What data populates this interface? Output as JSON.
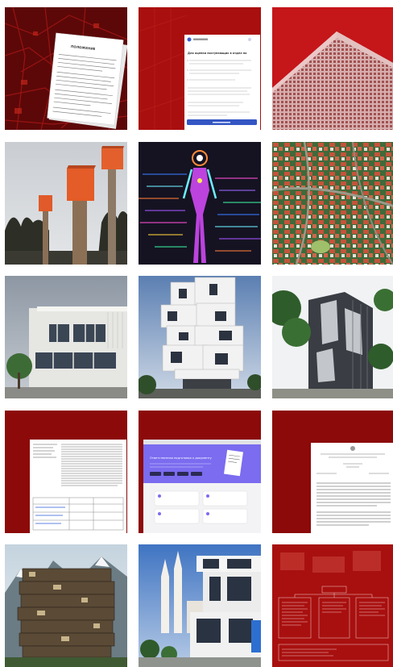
{
  "gallery": {
    "tiles": [
      {
        "id": "tile-1",
        "subject": "Paper document on red map background",
        "doc_title": "ПОЛОЖЕНИЕ"
      },
      {
        "id": "tile-2",
        "subject": "Web form dialog on red background",
        "form_title": "Для оценки поступающих в отдел по"
      },
      {
        "id": "tile-3",
        "subject": "Red building perspective"
      },
      {
        "id": "tile-4",
        "subject": "Orange birdhouses on poles"
      },
      {
        "id": "tile-5",
        "subject": "Neon digital robot figure"
      },
      {
        "id": "tile-6",
        "subject": "Aerial view of red-roofed houses"
      },
      {
        "id": "tile-7",
        "subject": "Modern white building with trees"
      },
      {
        "id": "tile-8",
        "subject": "Stacked cubic white apartment tower"
      },
      {
        "id": "tile-9",
        "subject": "Dark glass modern office building"
      },
      {
        "id": "tile-10",
        "subject": "Document with text table on red"
      },
      {
        "id": "tile-11",
        "subject": "Purple web page screenshot on red",
        "page_heading": "Ответственная подготовка к документу"
      },
      {
        "id": "tile-12",
        "subject": "Formal document page on red"
      },
      {
        "id": "tile-13",
        "subject": "Stacked ruined house in mountains"
      },
      {
        "id": "tile-14",
        "subject": "White building with church towers"
      },
      {
        "id": "tile-15",
        "subject": "Red flowchart diagram"
      }
    ]
  },
  "colors": {
    "red": "#b0100f",
    "dark_red": "#7a0808",
    "purple": "#7b6cf0"
  }
}
